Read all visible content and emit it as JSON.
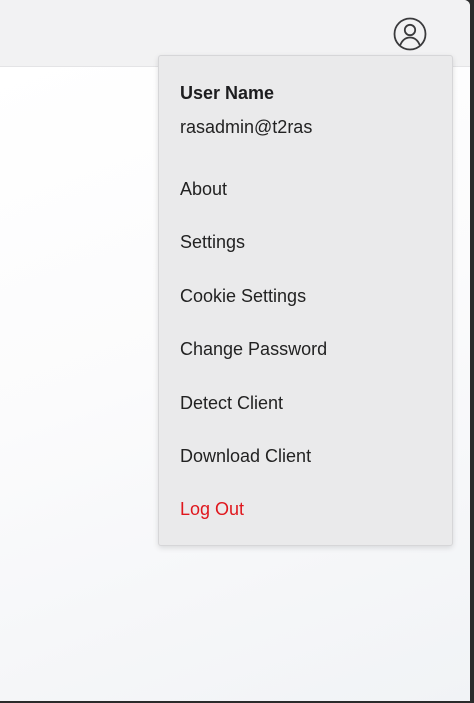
{
  "user": {
    "name": "User Name",
    "email": "rasadmin@t2ras"
  },
  "menu": {
    "items": [
      {
        "label": "About"
      },
      {
        "label": "Settings"
      },
      {
        "label": "Cookie Settings"
      },
      {
        "label": "Change Password"
      },
      {
        "label": "Detect Client"
      },
      {
        "label": "Download Client"
      },
      {
        "label": "Log Out"
      }
    ]
  },
  "icons": {
    "account": "user-circle-icon"
  },
  "colors": {
    "logout": "#e0171d",
    "menu_bg": "#eaeaeb",
    "topbar_bg": "#f2f2f3"
  }
}
